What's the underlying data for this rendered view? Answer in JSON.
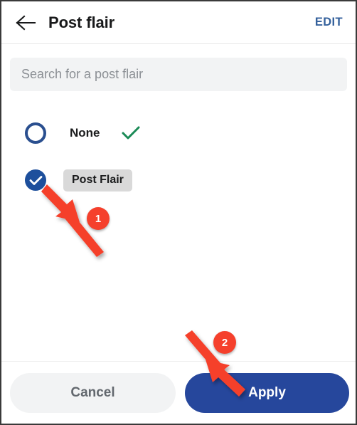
{
  "header": {
    "back_icon": "arrow-left-icon",
    "title": "Post flair",
    "edit_label": "EDIT"
  },
  "search": {
    "placeholder": "Search for a post flair",
    "value": ""
  },
  "options": [
    {
      "id": "none",
      "label": "None",
      "selected": false,
      "control": "radio-outline",
      "trailing_icon": "green-check-icon"
    },
    {
      "id": "post-flair",
      "label": "Post Flair",
      "selected": true,
      "control": "radio-checked",
      "style": "pill"
    }
  ],
  "footer": {
    "cancel_label": "Cancel",
    "apply_label": "Apply"
  },
  "annotations": [
    {
      "number": "1",
      "target": "post-flair-checkbox"
    },
    {
      "number": "2",
      "target": "apply-button"
    }
  ],
  "colors": {
    "accent_blue": "#26479c",
    "radio_blue": "#1d4f9c",
    "edit_blue": "#34619c",
    "green_check": "#1a8a56",
    "annotation_red": "#f5402c",
    "field_gray": "#f2f3f4",
    "pill_gray": "#d9d9d9"
  }
}
